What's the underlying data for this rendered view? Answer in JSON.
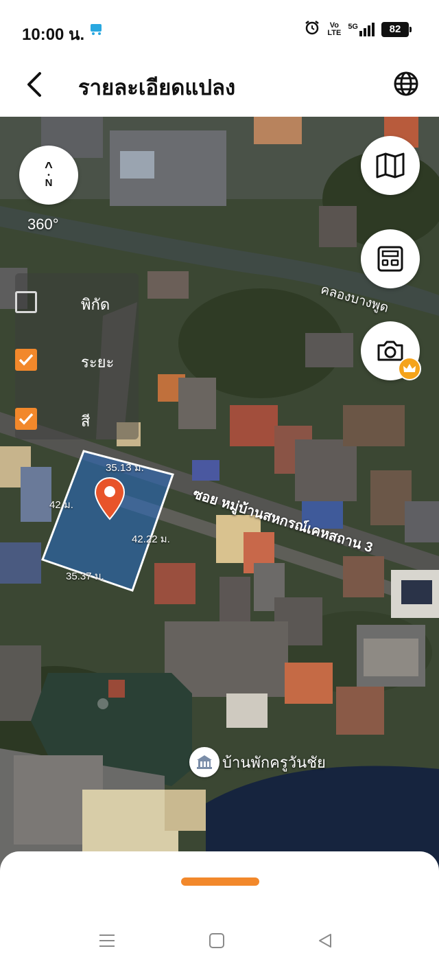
{
  "status_bar": {
    "time": "10:00 น.",
    "volte_top": "Vo",
    "volte_bottom": "LTE",
    "network": "5G",
    "battery": "82"
  },
  "header": {
    "title": "รายละเอียดแปลง"
  },
  "map": {
    "compass_arrow": "^",
    "compass_letter": "N",
    "heading": "360°",
    "layers": [
      {
        "label": "พิกัด",
        "checked": false
      },
      {
        "label": "ระยะ",
        "checked": true
      },
      {
        "label": "สี",
        "checked": true
      }
    ],
    "plot_dimensions": {
      "top": "35.13 ม.",
      "left": "42 ม.",
      "right": "42.22 ม.",
      "bottom": "35.37 ม."
    },
    "road_labels": {
      "canal": "คลองบางพูด",
      "soi": "ซอย หมู่บ้านสหกรณ์เคหสถาน 3"
    },
    "poi": {
      "name": "บ้านพักครูวันชัย",
      "icon": "building-icon"
    }
  },
  "colors": {
    "accent": "#f2882b",
    "pin": "#e8542a",
    "crown": "#f5a31b"
  }
}
